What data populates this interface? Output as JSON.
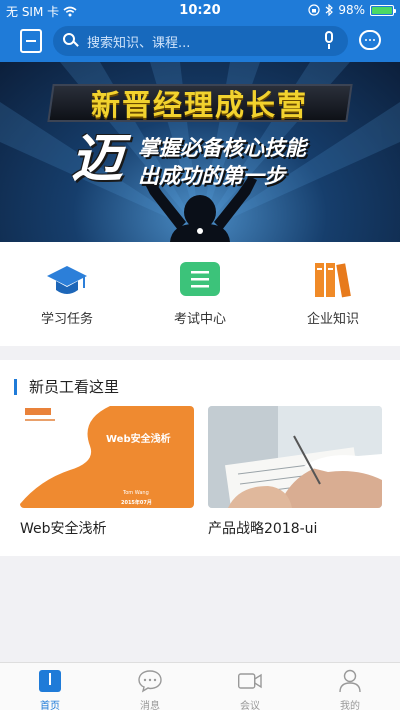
{
  "status_bar": {
    "carrier": "无 SIM 卡",
    "time": "10:20",
    "battery": "98%",
    "battery_level": 0.98,
    "icons": [
      "wifi-icon",
      "lock-rotation-icon",
      "bluetooth-icon",
      "battery-icon"
    ]
  },
  "header": {
    "search_placeholder": "搜索知识、课程...",
    "icons": [
      "scan-icon",
      "search-icon",
      "mic-icon",
      "chat-icon"
    ],
    "accent_color": "#1f7bd8"
  },
  "banner": {
    "title": "新晋经理成长营",
    "big_char": "迈",
    "line1": "掌握必备核心技能",
    "line2": "出成功的第一步",
    "pager_current": 1
  },
  "quick_entries": [
    {
      "label": "学习任务",
      "icon": "graduation-cap-icon",
      "color": "#2c7fd9"
    },
    {
      "label": "考试中心",
      "icon": "exam-list-icon",
      "color": "#3cc37a"
    },
    {
      "label": "企业知识",
      "icon": "books-icon",
      "color": "#f08a27"
    }
  ],
  "section": {
    "title": "新员工看这里",
    "cards": [
      {
        "caption": "Web安全浅析",
        "thumb_title": "Web安全浅析",
        "thumb_author": "Tom Wang",
        "thumb_date": "2015年07月"
      },
      {
        "caption": "产品战略2018-ui"
      }
    ]
  },
  "tabs": [
    {
      "label": "首页",
      "icon": "book-icon",
      "active": true
    },
    {
      "label": "消息",
      "icon": "message-icon",
      "active": false
    },
    {
      "label": "会议",
      "icon": "video-camera-icon",
      "active": false
    },
    {
      "label": "我的",
      "icon": "person-icon",
      "active": false
    }
  ]
}
